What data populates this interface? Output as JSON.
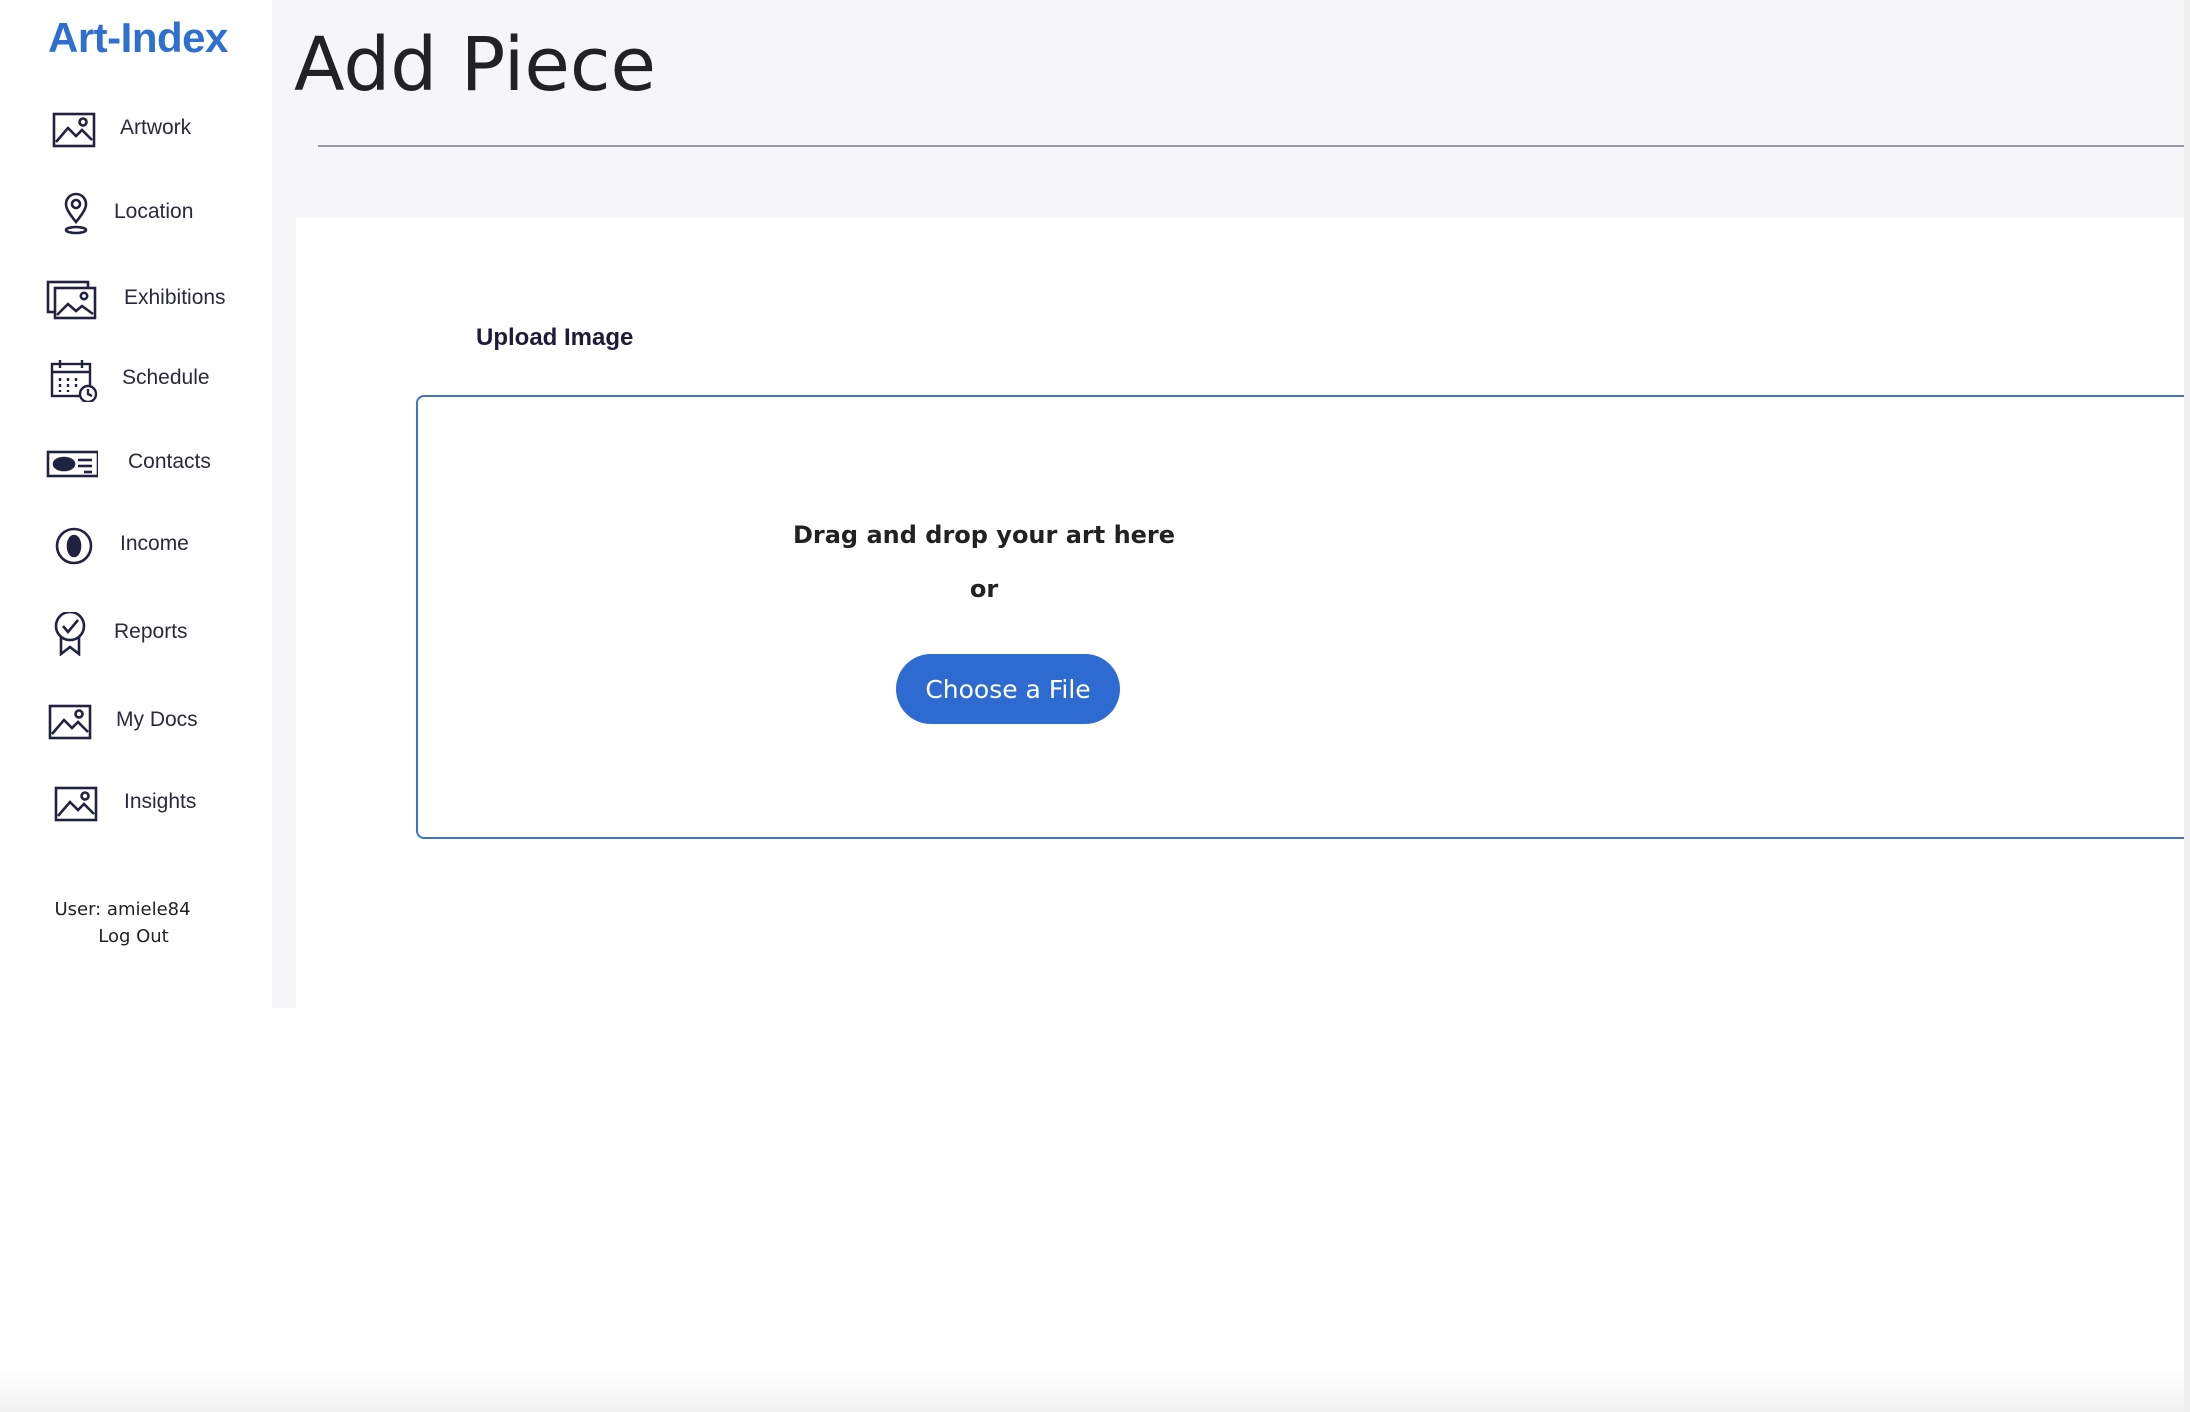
{
  "app": {
    "logo": "Art-Index"
  },
  "sidebar": {
    "items": [
      {
        "label": "Artwork",
        "icon": "image-icon"
      },
      {
        "label": "Location",
        "icon": "map-pin-icon"
      },
      {
        "label": "Exhibitions",
        "icon": "gallery-icon"
      },
      {
        "label": "Schedule",
        "icon": "calendar-clock-icon"
      },
      {
        "label": "Contacts",
        "icon": "id-card-icon"
      },
      {
        "label": "Income",
        "icon": "coin-icon"
      },
      {
        "label": "Reports",
        "icon": "badge-check-icon"
      },
      {
        "label": "My Docs",
        "icon": "image-icon"
      },
      {
        "label": "Insights",
        "icon": "image-icon"
      }
    ],
    "user_label": "User: amiele84",
    "logout_label": "Log Out"
  },
  "main": {
    "title": "Add Piece",
    "section_label": "Upload Image",
    "dropzone": {
      "text": "Drag and drop your art here",
      "or": "or",
      "button_label": "Choose a File"
    }
  },
  "colors": {
    "accent": "#2f6fd0",
    "button": "#2e6bd0",
    "icon_stroke": "#1f2340",
    "main_bg": "#f6f6f9"
  }
}
